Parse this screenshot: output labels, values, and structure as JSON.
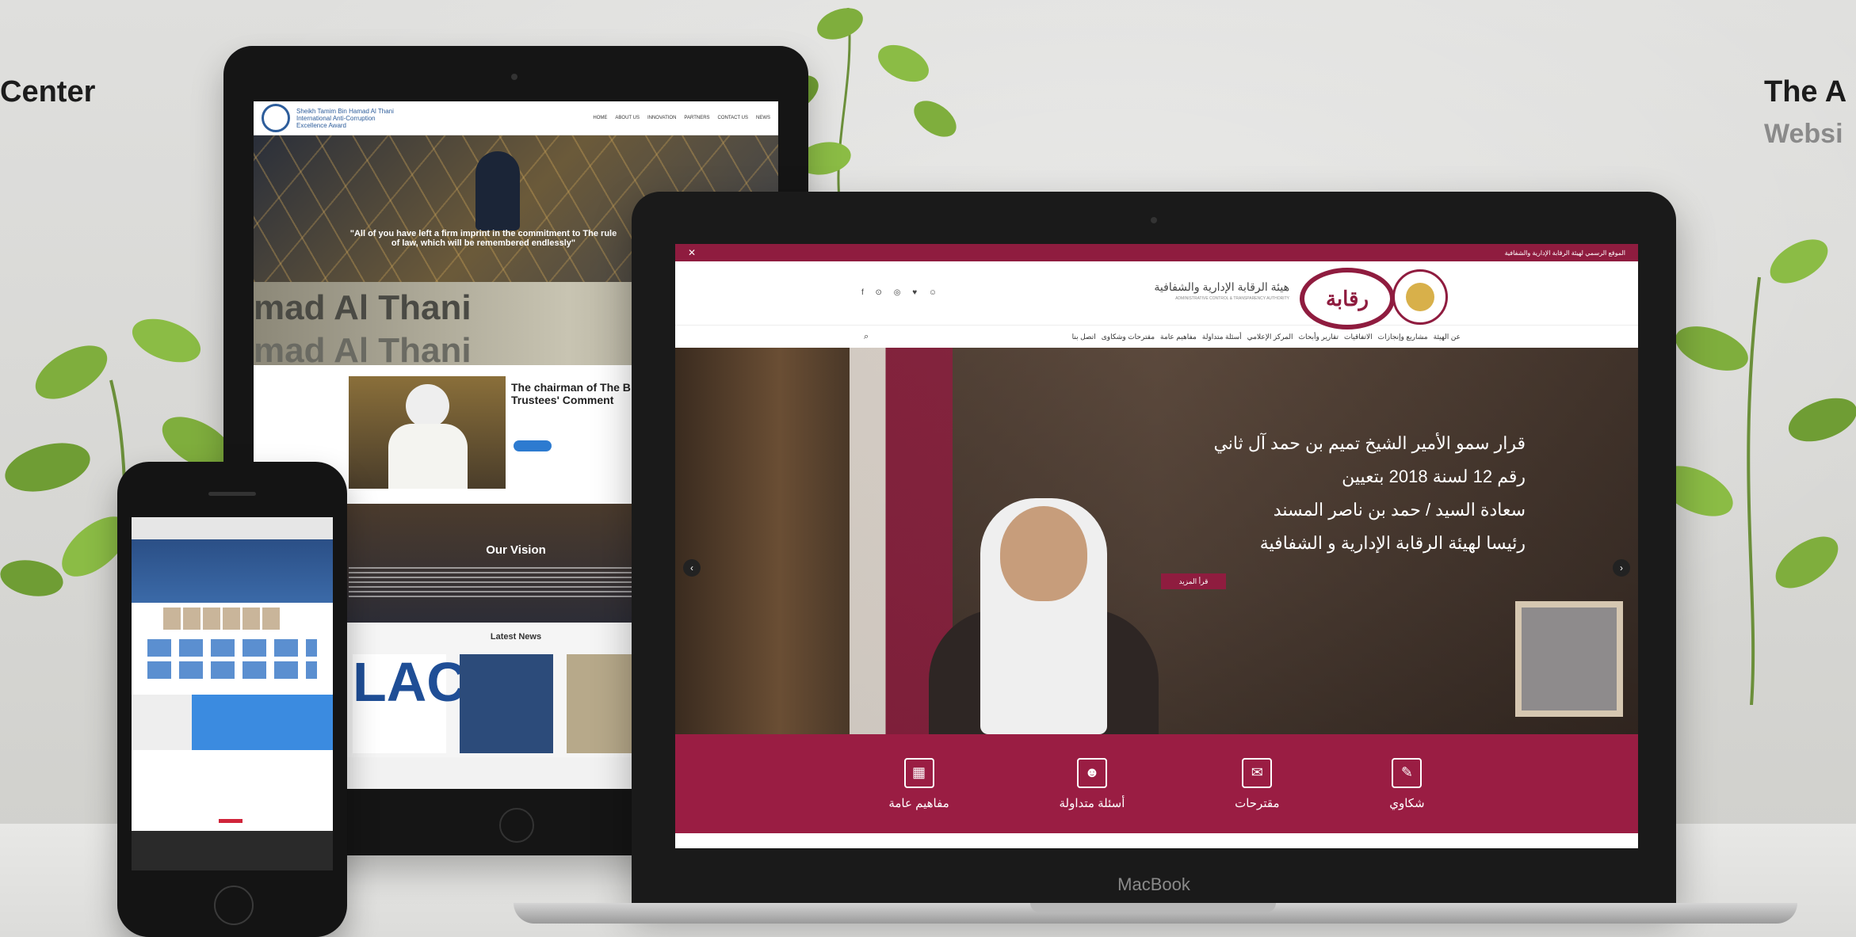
{
  "corner_left": "Center",
  "corner_right": {
    "title": "The A",
    "subtitle": "Websi"
  },
  "tablet": {
    "org_name": "Sheikh Tamim Bin Hamad Al Thani International Anti-Corruption Excellence Award",
    "nav": [
      "HOME",
      "ABOUT US",
      "INNOVATION",
      "PARTNERS",
      "CONTACT US",
      "NEWS"
    ],
    "hero_quote": "\"All of you have left a firm imprint in the commitment to The rule of law, which will be remembered endlessly\"",
    "award_text": "mad Al Thani",
    "chairman_title": "The chairman of The B Trustees' Comment",
    "vision_title": "Our Vision",
    "news_title": "Latest News",
    "news_lac": "LAC"
  },
  "laptop": {
    "brand": "MacBook",
    "topbar_text": "الموقع الرسمي لهيئة الرقابة الإدارية والشفافية",
    "social": "f ⊙ ◎ ♥ ☺",
    "raqaba_logo": "رقابة",
    "org_name_ar": "هيئة الرقابة الإدارية والشفافية",
    "org_name_en": "ADMINISTRATIVE CONTROL & TRANSPARENCY AUTHORITY",
    "menu": [
      "عن الهيئة",
      "مشاريع وإنجازات",
      "الاتفاقيات",
      "تقارير وأبحاث",
      "المركز الإعلامي",
      "أسئلة متداولة",
      "مفاهيم عامة",
      "مقترحات وشكاوى",
      "اتصل بنا"
    ],
    "hero_lines": [
      "قرار سمو الأمير الشيخ تميم بن حمد آل ثاني",
      "رقم 12 لسنة 2018 بتعيين",
      "سعادة السيد / حمد بن ناصر المسند",
      "رئيسا لهيئة الرقابة الإدارية و الشفافية"
    ],
    "hero_button": "قرأ المزيد",
    "tiles": [
      {
        "label": "مفاهيم عامة",
        "icon": "grid-document-icon"
      },
      {
        "label": "أسئلة متداولة",
        "icon": "person-question-icon"
      },
      {
        "label": "مقترحات",
        "icon": "suggestion-box-icon"
      },
      {
        "label": "شكاوي",
        "icon": "complaint-form-icon"
      }
    ]
  },
  "colors": {
    "maroon": "#8f1c3f",
    "maroon_band": "#9a1d43",
    "tablet_blue": "#2d5d9b"
  }
}
